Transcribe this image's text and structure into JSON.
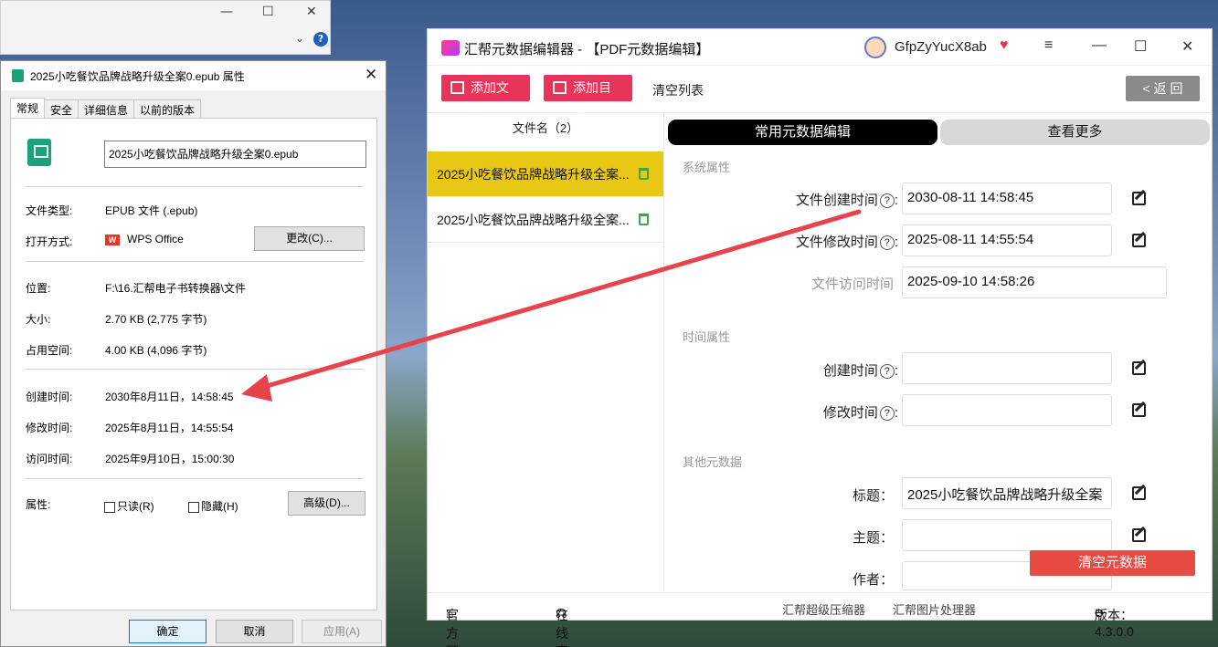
{
  "bg_window": {
    "minimize": "—",
    "maximize": "☐",
    "close": "✕",
    "help": "?",
    "chevron": "⌄"
  },
  "props": {
    "title": "2025小吃餐饮品牌战略升级全案0.epub 属性",
    "close": "✕",
    "tabs": [
      "常规",
      "安全",
      "详细信息",
      "以前的版本"
    ],
    "filename": "2025小吃餐饮品牌战略升级全案0.epub",
    "rows": {
      "type_label": "文件类型:",
      "type_value": "EPUB 文件 (.epub)",
      "open_label": "打开方式:",
      "open_value": "WPS Office",
      "change_btn": "更改(C)...",
      "loc_label": "位置:",
      "loc_value": "F:\\16.汇帮电子书转换器\\文件",
      "size_label": "大小:",
      "size_value": "2.70 KB (2,775 字节)",
      "disk_label": "占用空间:",
      "disk_value": "4.00 KB (4,096 字节)",
      "created_label": "创建时间:",
      "created_value": "2030年8月11日，14:58:45",
      "modified_label": "修改时间:",
      "modified_value": "2025年8月11日，14:55:54",
      "accessed_label": "访问时间:",
      "accessed_value": "2025年9月10日，15:00:30",
      "attr_label": "属性:",
      "readonly": "只读(R)",
      "hidden": "隐藏(H)",
      "advanced": "高级(D)..."
    },
    "buttons": {
      "ok": "确定",
      "cancel": "取消",
      "apply": "应用(A)"
    },
    "wps_logo": "W"
  },
  "app": {
    "title": "汇帮元数据编辑器 - 【PDF元数据编辑】",
    "username": "GfpZyYucX8ab",
    "window_controls": {
      "menu": "≡",
      "minimize": "—",
      "maximize": "☐",
      "close": "✕"
    },
    "toolbar": {
      "add_file": "添加文件",
      "add_dir": "添加目录",
      "clear_list": "清空列表",
      "back": "< 返 回"
    },
    "list_header": "文件名（2）",
    "files": [
      "2025小吃餐饮品牌战略升级全案...",
      "2025小吃餐饮品牌战略升级全案..."
    ],
    "tabs": {
      "common": "常用元数据编辑",
      "more": "查看更多"
    },
    "sections": {
      "system": "系统属性",
      "time": "时间属性",
      "other": "其他元数据"
    },
    "fields": {
      "file_created": {
        "label": "文件创建时间",
        "value": "2030-08-11 14:58:45"
      },
      "file_modified": {
        "label": "文件修改时间",
        "value": "2025-08-11 14:55:54"
      },
      "file_accessed": {
        "label": "文件访问时间",
        "value": "2025-09-10 14:58:26"
      },
      "created": {
        "label": "创建时间",
        "value": ""
      },
      "modified": {
        "label": "修改时间",
        "value": ""
      },
      "title": {
        "label": "标题：",
        "value": "2025小吃餐饮品牌战略升级全案"
      },
      "subject": {
        "label": "主题：",
        "value": ""
      },
      "author": {
        "label": "作者：",
        "value": ""
      }
    },
    "help_mark": "?",
    "colon": ":",
    "clear_metadata": "清空元数据",
    "footer": {
      "website": "官方网站",
      "support": "在线客服",
      "compressor": "汇帮超级压缩器",
      "image_tool": "汇帮图片处理器",
      "version": "版本：4.3.0.0"
    },
    "colors": {
      "pink": "#e8345a",
      "selected": "#e8c814",
      "red": "#e84a44"
    }
  }
}
